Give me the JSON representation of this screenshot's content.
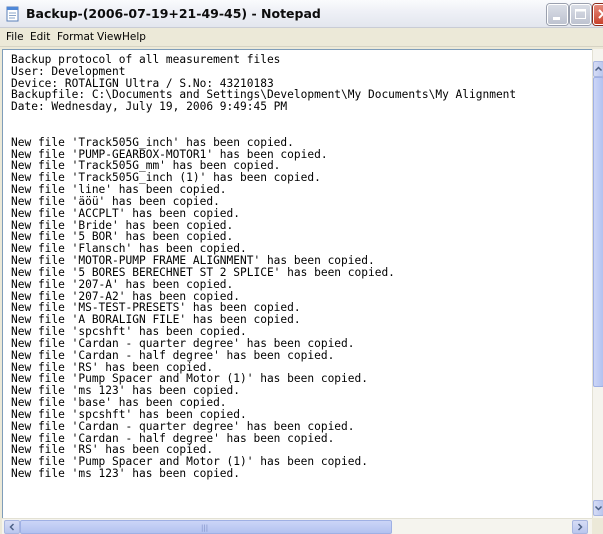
{
  "window": {
    "title": "Backup-(2006-07-19+21-49-45) - Notepad",
    "app_icon": "notepad-icon",
    "controls": [
      "minimize-icon",
      "maximize-icon",
      "close-icon"
    ]
  },
  "menu": [
    {
      "label": "File"
    },
    {
      "label": "Edit"
    },
    {
      "label": "Format"
    },
    {
      "label": "View"
    },
    {
      "label": "Help"
    }
  ],
  "document": {
    "lines": [
      "Backup protocol of all measurement files",
      "User: Development",
      "Device: ROTALIGN Ultra / S.No: 43210183",
      "Backupfile: C:\\Documents and Settings\\Development\\My Documents\\My Alignment",
      "Date: Wednesday, July 19, 2006 9:49:45 PM",
      "",
      "",
      "New file 'Track505G_inch' has been copied.",
      "New file 'PUMP-GEARBOX-MOTOR1' has been copied.",
      "New file 'Track505G_mm' has been copied.",
      "New file 'Track505G_inch (1)' has been copied.",
      "New file 'line' has been copied.",
      "New file 'äöü' has been copied.",
      "New file 'ACCPLT' has been copied.",
      "New file 'Bride' has been copied.",
      "New file '5 BOR' has been copied.",
      "New file 'Flansch' has been copied.",
      "New file 'MOTOR-PUMP FRAME ALIGNMENT' has been copied.",
      "New file '5 BORES BERECHNET ST 2 SPLICE' has been copied.",
      "New file '207-A' has been copied.",
      "New file '207-A2' has been copied.",
      "New file 'MS-TEST-PRESETS' has been copied.",
      "New file 'A BORALIGN FILE' has been copied.",
      "New file 'spcshft' has been copied.",
      "New file 'Cardan - quarter degree' has been copied.",
      "New file 'Cardan - half degree' has been copied.",
      "New file 'RS' has been copied.",
      "New file 'Pump Spacer and Motor (1)' has been copied.",
      "New file 'ms 123' has been copied.",
      "New file 'base' has been copied.",
      "New file 'spcshft' has been copied.",
      "New file 'Cardan - quarter degree' has been copied.",
      "New file 'Cardan - half degree' has been copied.",
      "New file 'RS' has been copied.",
      "New file 'Pump Spacer and Motor (1)' has been copied.",
      "New file 'ms 123' has been copied."
    ]
  },
  "scrollbars": {
    "vertical": {
      "up": "arrow-up-icon",
      "down": "arrow-down-icon"
    },
    "horizontal": {
      "left": "arrow-left-icon",
      "right": "arrow-right-icon"
    }
  }
}
